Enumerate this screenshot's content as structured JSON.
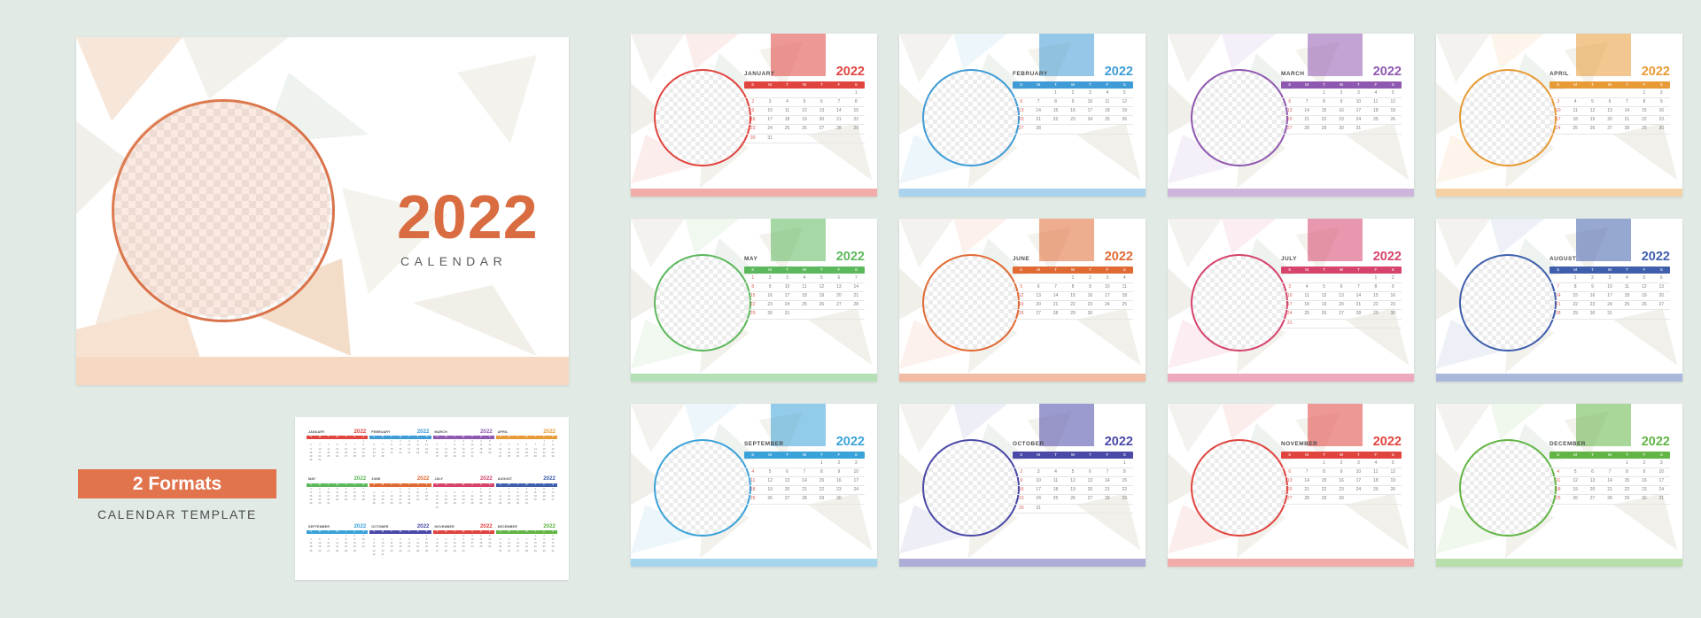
{
  "cover": {
    "year": "2022",
    "subtitle": "CALENDAR",
    "accent": "#d96c41"
  },
  "formats": {
    "badge_label": "2 Formats",
    "subtitle": "CALENDAR TEMPLATE",
    "badge_color": "#e1744c"
  },
  "year_label": "2022",
  "dow": [
    "S",
    "M",
    "T",
    "W",
    "T",
    "F",
    "S"
  ],
  "months": [
    {
      "name": "JANUARY",
      "color": "#e0443f",
      "start": 6,
      "days": 31
    },
    {
      "name": "FEBRUARY",
      "color": "#3e9bd6",
      "start": 2,
      "days": 28
    },
    {
      "name": "MARCH",
      "color": "#8f58b0",
      "start": 2,
      "days": 31
    },
    {
      "name": "APRIL",
      "color": "#e79a35",
      "start": 5,
      "days": 30
    },
    {
      "name": "MAY",
      "color": "#5cb85c",
      "start": 0,
      "days": 31
    },
    {
      "name": "JUNE",
      "color": "#e06a33",
      "start": 3,
      "days": 30
    },
    {
      "name": "JULY",
      "color": "#d6436b",
      "start": 5,
      "days": 31
    },
    {
      "name": "AUGUST",
      "color": "#3f5fad",
      "start": 1,
      "days": 31
    },
    {
      "name": "SEPTEMBER",
      "color": "#3aa2d9",
      "start": 4,
      "days": 30
    },
    {
      "name": "OCTOBER",
      "color": "#4a49a8",
      "start": 6,
      "days": 31
    },
    {
      "name": "NOVEMBER",
      "color": "#e0443f",
      "start": 2,
      "days": 30
    },
    {
      "name": "DECEMBER",
      "color": "#62b545",
      "start": 4,
      "days": 31
    }
  ]
}
